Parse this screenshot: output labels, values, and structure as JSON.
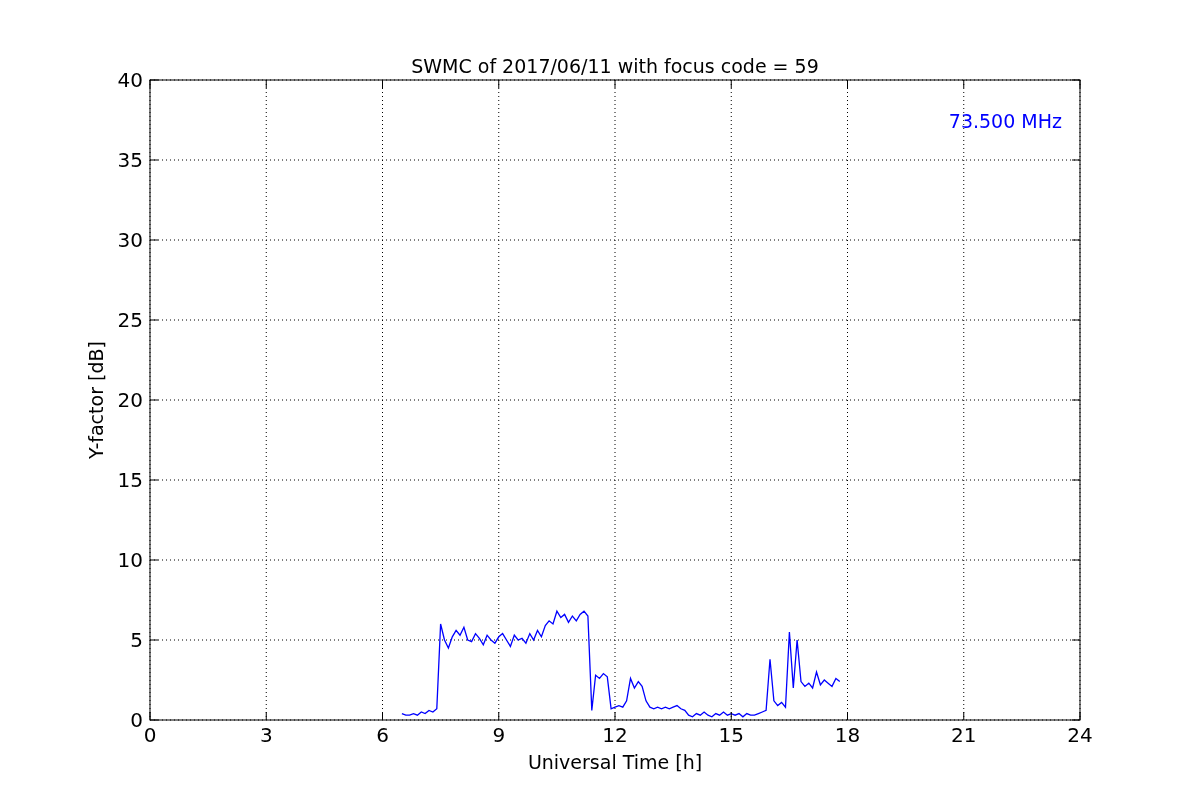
{
  "chart_data": {
    "type": "line",
    "title": "SWMC of 2017/06/11 with focus code = 59",
    "xlabel": "Universal Time [h]",
    "ylabel": "Y-factor [dB]",
    "xlim": [
      0,
      24
    ],
    "ylim": [
      0,
      40
    ],
    "xticks": [
      0,
      3,
      6,
      9,
      12,
      15,
      18,
      21,
      24
    ],
    "yticks": [
      0,
      5,
      10,
      15,
      20,
      25,
      30,
      35,
      40
    ],
    "x": [
      6.5,
      6.6,
      6.7,
      6.8,
      6.9,
      7.0,
      7.1,
      7.2,
      7.3,
      7.4,
      7.5,
      7.6,
      7.7,
      7.8,
      7.9,
      8.0,
      8.1,
      8.2,
      8.3,
      8.4,
      8.5,
      8.6,
      8.7,
      8.8,
      8.9,
      9.0,
      9.1,
      9.2,
      9.3,
      9.4,
      9.5,
      9.6,
      9.7,
      9.8,
      9.9,
      10.0,
      10.1,
      10.2,
      10.3,
      10.4,
      10.5,
      10.6,
      10.7,
      10.8,
      10.9,
      11.0,
      11.1,
      11.2,
      11.3,
      11.4,
      11.5,
      11.6,
      11.7,
      11.8,
      11.9,
      12.0,
      12.1,
      12.2,
      12.3,
      12.4,
      12.5,
      12.6,
      12.7,
      12.8,
      12.9,
      13.0,
      13.1,
      13.2,
      13.3,
      13.4,
      13.5,
      13.6,
      13.7,
      13.8,
      13.9,
      14.0,
      14.1,
      14.2,
      14.3,
      14.4,
      14.5,
      14.6,
      14.7,
      14.8,
      14.9,
      15.0,
      15.1,
      15.2,
      15.3,
      15.4,
      15.5,
      15.6,
      15.7,
      15.8,
      15.9,
      16.0,
      16.1,
      16.2,
      16.3,
      16.4,
      16.5,
      16.6,
      16.7,
      16.8,
      16.9,
      17.0,
      17.1,
      17.2,
      17.3,
      17.4,
      17.5,
      17.6,
      17.7,
      17.8
    ],
    "series": [
      {
        "color": "#0000ff",
        "values": [
          0.4,
          0.3,
          0.3,
          0.4,
          0.3,
          0.5,
          0.4,
          0.6,
          0.5,
          0.7,
          6.0,
          5.0,
          4.5,
          5.2,
          5.6,
          5.3,
          5.8,
          5.0,
          4.9,
          5.4,
          5.1,
          4.7,
          5.3,
          5.0,
          4.8,
          5.2,
          5.4,
          5.0,
          4.6,
          5.3,
          5.0,
          5.1,
          4.8,
          5.4,
          5.0,
          5.6,
          5.2,
          5.9,
          6.2,
          6.0,
          6.8,
          6.4,
          6.6,
          6.1,
          6.5,
          6.2,
          6.6,
          6.8,
          6.5,
          0.6,
          2.8,
          2.6,
          2.9,
          2.7,
          0.7,
          0.8,
          0.9,
          0.8,
          1.2,
          2.6,
          2.0,
          2.4,
          2.1,
          1.2,
          0.8,
          0.7,
          0.8,
          0.7,
          0.8,
          0.7,
          0.8,
          0.9,
          0.7,
          0.6,
          0.3,
          0.2,
          0.4,
          0.3,
          0.5,
          0.3,
          0.2,
          0.4,
          0.3,
          0.5,
          0.3,
          0.4,
          0.3,
          0.4,
          0.2,
          0.4,
          0.3,
          0.3,
          0.4,
          0.5,
          0.6,
          3.8,
          1.2,
          0.9,
          1.1,
          0.8,
          5.5,
          2.0,
          5.0,
          2.4,
          2.1,
          2.3,
          2.0,
          3.0,
          2.2,
          2.5,
          2.3,
          2.1,
          2.6,
          2.4
        ]
      }
    ],
    "grid": true,
    "annotations": [
      "73.500 MHz"
    ]
  }
}
